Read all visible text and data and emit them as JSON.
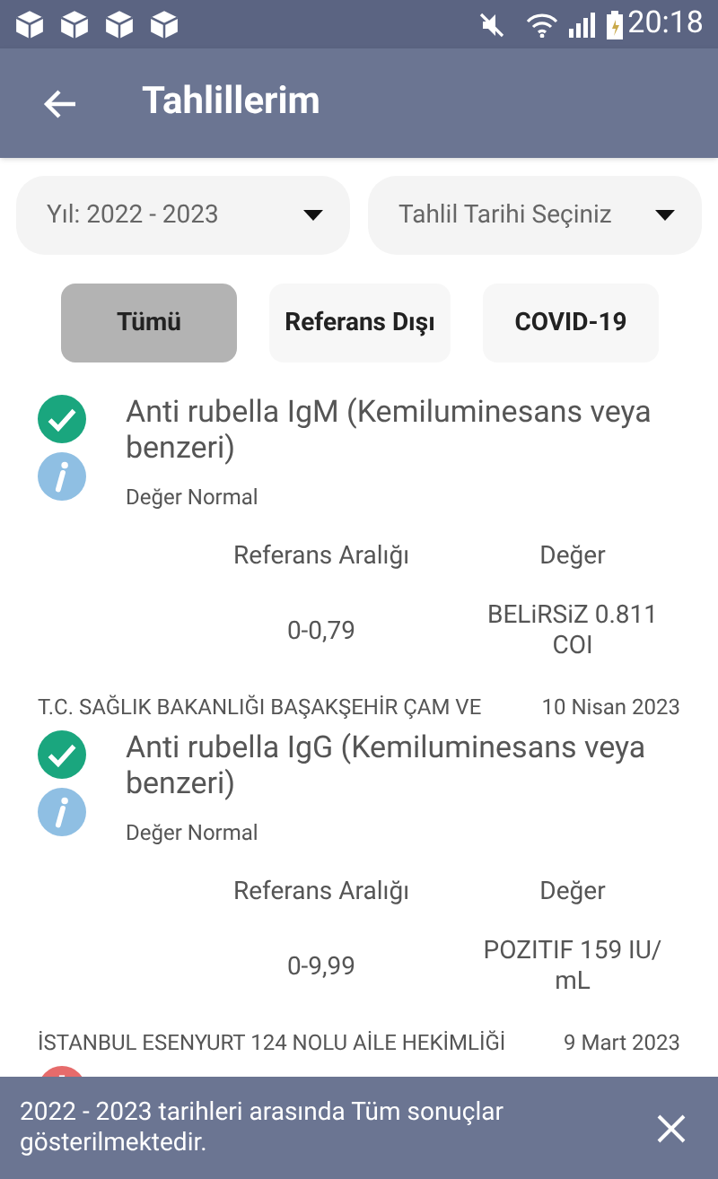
{
  "status_bar": {
    "time": "20:18",
    "notifications": [
      {
        "kind": "package"
      },
      {
        "kind": "package"
      },
      {
        "kind": "package"
      },
      {
        "kind": "package"
      }
    ]
  },
  "app_bar": {
    "title": "Tahlillerim"
  },
  "filters": [
    {
      "value": "Yıl: 2022 - 2023"
    },
    {
      "value": "Tahlil Tarihi Seçiniz"
    }
  ],
  "tabs": [
    {
      "label": "Tümü",
      "selected": true
    },
    {
      "label": "Referans Dışı",
      "selected": false
    },
    {
      "label": "COVID-19",
      "selected": false
    }
  ],
  "results": [
    {
      "kind": "normal",
      "test": "Anti rubella IgM (Kemiluminesans veya benzeri)",
      "note": "Değer Normal",
      "range_label": "Referans Aralığı",
      "value_label": "Değer",
      "range": "0-0,79",
      "value": "BELiRSiZ 0.811 COI"
    },
    {
      "institution": "T.C. SAĞLIK BAKANLIĞI BAŞAKŞEHİR ÇAM VE",
      "date": "10 Nisan 2023",
      "kind": "normal",
      "test": "Anti rubella IgG (Kemiluminesans veya benzeri)",
      "note": "Değer Normal",
      "range_label": "Referans Aralığı",
      "value_label": "Değer",
      "range": "0-9,99",
      "value": "POZITIF 159 IU/ mL"
    },
    {
      "institution": "İSTANBUL ESENYURT 124 NOLU AİLE HEKİMLİĞİ",
      "date": "9 Mart 2023",
      "kind": "abnormal"
    }
  ],
  "snackbar": {
    "message": "2022 - 2023 tarihleri arasında Tüm sonuçlar gösterilmektedir."
  }
}
